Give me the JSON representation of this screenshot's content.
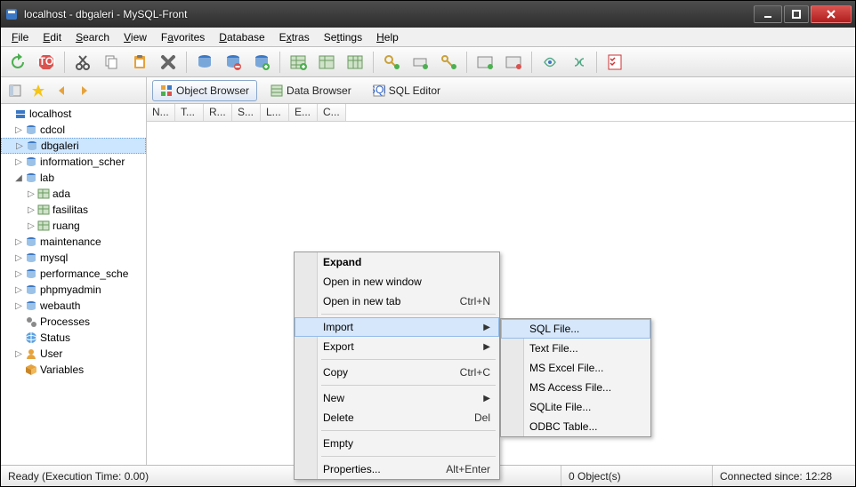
{
  "window": {
    "title": "localhost - dbgaleri - MySQL-Front"
  },
  "menu": [
    "File",
    "Edit",
    "Search",
    "View",
    "Favorites",
    "Database",
    "Extras",
    "Settings",
    "Help"
  ],
  "tabs": {
    "object": "Object Browser",
    "data": "Data Browser",
    "sql": "SQL Editor"
  },
  "columns": [
    "N...",
    "T...",
    "R...",
    "S...",
    "L...",
    "E...",
    "C..."
  ],
  "tree": {
    "root": "localhost",
    "dbs": [
      {
        "name": "cdcol",
        "expanded": false
      },
      {
        "name": "dbgaleri",
        "expanded": false,
        "selected": true
      },
      {
        "name": "information_schema",
        "expanded": false,
        "truncated": "information_scher"
      },
      {
        "name": "lab",
        "expanded": true,
        "tables": [
          "ada",
          "fasilitas",
          "ruang"
        ]
      },
      {
        "name": "maintenance",
        "expanded": false
      },
      {
        "name": "mysql",
        "expanded": false
      },
      {
        "name": "performance_schema",
        "expanded": false,
        "truncated": "performance_sche"
      },
      {
        "name": "phpmyadmin",
        "expanded": false
      },
      {
        "name": "webauth",
        "expanded": false
      }
    ],
    "utilities": [
      {
        "name": "Processes",
        "icon": "gears"
      },
      {
        "name": "Status",
        "icon": "globe"
      },
      {
        "name": "User",
        "icon": "user"
      },
      {
        "name": "Variables",
        "icon": "cube"
      }
    ]
  },
  "context_menu": [
    {
      "label": "Expand",
      "bold": true
    },
    {
      "label": "Open in new window"
    },
    {
      "label": "Open in new tab",
      "shortcut": "Ctrl+N"
    },
    {
      "sep": true
    },
    {
      "label": "Import",
      "submenu": true,
      "hover": true
    },
    {
      "label": "Export",
      "submenu": true
    },
    {
      "sep": true
    },
    {
      "label": "Copy",
      "shortcut": "Ctrl+C"
    },
    {
      "sep": true
    },
    {
      "label": "New",
      "submenu": true
    },
    {
      "label": "Delete",
      "shortcut": "Del"
    },
    {
      "sep": true
    },
    {
      "label": "Empty"
    },
    {
      "sep": true
    },
    {
      "label": "Properties...",
      "shortcut": "Alt+Enter"
    }
  ],
  "import_submenu": [
    {
      "label": "SQL File...",
      "hover": true
    },
    {
      "label": "Text File..."
    },
    {
      "label": "MS Excel File..."
    },
    {
      "label": "MS Access File..."
    },
    {
      "label": "SQLite File..."
    },
    {
      "label": "ODBC Table..."
    }
  ],
  "status": {
    "left": "Ready   (Execution Time: 0.00)",
    "objects": "0 Object(s)",
    "connected": "Connected since: 12:28"
  }
}
